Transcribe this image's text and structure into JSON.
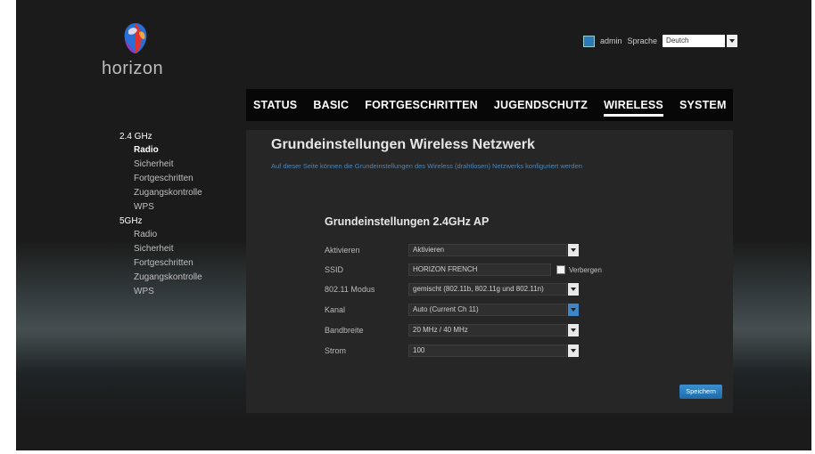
{
  "brand": {
    "name": "horizon"
  },
  "topbar": {
    "user": "admin",
    "language_label": "Sprache",
    "language_value": "Deutch"
  },
  "nav": {
    "items": [
      {
        "label": "STATUS"
      },
      {
        "label": "BASIC"
      },
      {
        "label": "FORTGESCHRITTEN"
      },
      {
        "label": "JUGENDSCHUTZ"
      },
      {
        "label": "WIRELESS",
        "active": true
      },
      {
        "label": "SYSTEM"
      }
    ]
  },
  "sidebar": {
    "groups": [
      {
        "label": "2.4 GHz",
        "items": [
          "Radio",
          "Sicherheit",
          "Fortgeschritten",
          "Zugangskontrolle",
          "WPS"
        ]
      },
      {
        "label": "5GHz",
        "items": [
          "Radio",
          "Sicherheit",
          "Fortgeschritten",
          "Zugangskontrolle",
          "WPS"
        ]
      }
    ]
  },
  "main": {
    "title": "Grundeinstellungen Wireless Netzwerk",
    "description": "Auf dieser Seite können die Grundeinstellungen des Wireless (drahtlosen) Netzwerks konfiguriert werden",
    "section_title": "Grundeinstellungen 2.4GHz AP",
    "fields": {
      "aktivieren": {
        "label": "Aktivieren",
        "value": "Aktivieren"
      },
      "ssid": {
        "label": "SSID",
        "value": "HORIZON FRENCH",
        "hide_label": "Verbergen"
      },
      "modus": {
        "label": "802.11 Modus",
        "value": "gemischt (802.11b, 802.11g und 802.11n)"
      },
      "kanal": {
        "label": "Kanal",
        "value": "Auto (Current Ch 11)"
      },
      "bandbreite": {
        "label": "Bandbreite",
        "value": "20 MHz / 40 MHz"
      },
      "strom": {
        "label": "Strom",
        "value": "100"
      }
    },
    "save_label": "Speichern"
  },
  "colors": {
    "background": "#1b1b1b",
    "panel": "#262626",
    "accent_blue": "#2d7fc1",
    "description_blue": "#4e86b6"
  }
}
